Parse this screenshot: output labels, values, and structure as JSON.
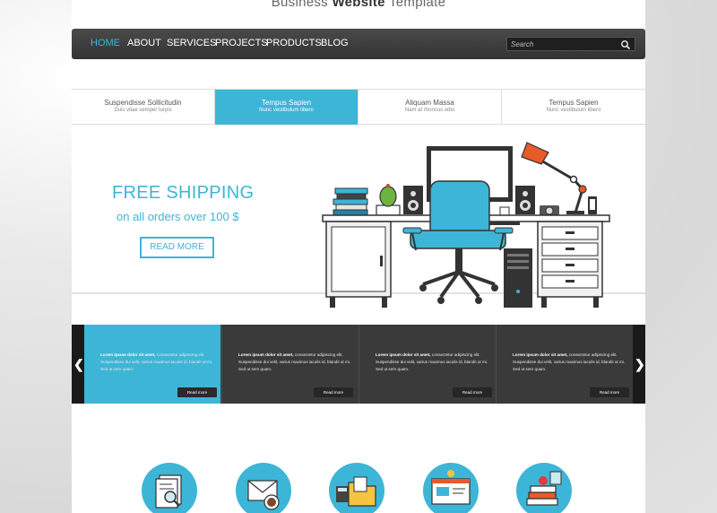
{
  "site": {
    "title_prefix": "Business ",
    "title_bold": "Website",
    "title_suffix": " Template"
  },
  "nav": {
    "items": [
      "HOME",
      "ABOUT",
      "SERVICES",
      "PROJECTS",
      "PRODUCTS",
      "BLOG"
    ],
    "active": "HOME",
    "search_placeholder": "Search"
  },
  "tabs": [
    {
      "title": "Suspendisse Sollicitudin",
      "subtitle": "Duis vitae semper turpis"
    },
    {
      "title": "Tempus Sapien",
      "subtitle": "Nunc vestibulum libero"
    },
    {
      "title": "Aliquam Massa",
      "subtitle": "Nam at rhoncus odio"
    },
    {
      "title": "Tempus Sapien",
      "subtitle": "Nunc vestibulum libero"
    }
  ],
  "hero": {
    "title": "FREE SHIPPING",
    "subtitle": "on all orders over 100 $",
    "button": "READ MORE"
  },
  "slider": {
    "cards": [
      {
        "lead": "Lorem ipsum dolor sit amet,",
        "text": " consectetur adipiscing elit. Suspendisse dui velit, varius maximus iaculis id, blandit ut mi. Sed ut sem quam.",
        "button": "Read more"
      },
      {
        "lead": "Lorem ipsum dolor sit amet,",
        "text": " consectetur adipiscing elit. Suspendisse dui velit, varius maximus iaculis id, blandit ut mi. Sed ut sem quam.",
        "button": "Read more"
      },
      {
        "lead": "Lorem ipsum dolor sit amet,",
        "text": " consectetur adipiscing elit. Suspendisse dui velit, varius maximus iaculis id, blandit ut mi. Sed ut sem quam.",
        "button": "Read more"
      },
      {
        "lead": "Lorem ipsum dolor sit amet,",
        "text": " consectetur adipiscing elit. Suspendisse dui velit, varius maximus iaculis id, blandit ut mi. Sed ut sem quam.",
        "button": "Read more"
      }
    ],
    "prev_icon": "chevron-left-icon",
    "next_icon": "chevron-right-icon"
  },
  "features": {
    "icons": [
      "resume-search-icon",
      "mail-coffee-icon",
      "folder-calculator-icon",
      "web-design-icon",
      "books-apple-icon"
    ]
  },
  "colors": {
    "accent": "#3db5d6",
    "nav_bg": "#3a3a3a",
    "slider_bg": "#3b3b3b"
  }
}
